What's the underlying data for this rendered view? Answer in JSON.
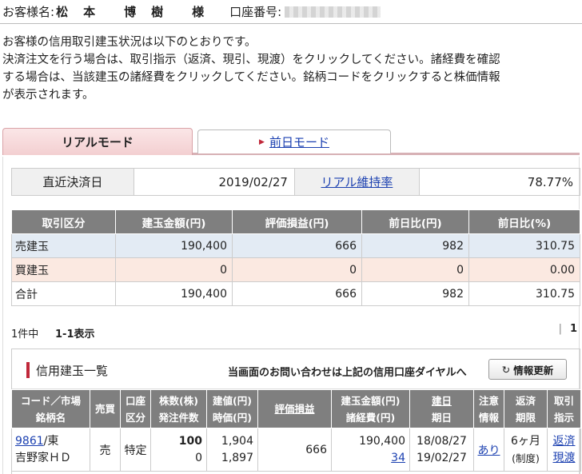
{
  "header": {
    "customer_label": "お客様名:",
    "customer_name": "松　本　　博　樹　　様",
    "account_label": "口座番号:"
  },
  "intro": {
    "line1": "お客様の信用取引建玉状況は以下のとおりです。",
    "line2": "決済注文を行う場合は、取引指示（返済、現引、現渡）をクリックしてください。諸経費を確認",
    "line3": "する場合は、当該建玉の諸経費をクリックしてください。銘柄コードをクリックすると株価情報",
    "line4": "が表示されます。"
  },
  "tabs": {
    "real": "リアルモード",
    "prev": "前日モード"
  },
  "summary": {
    "settle_label": "直近決済日",
    "settle_value": "2019/02/27",
    "ratio_label": "リアル維持率",
    "ratio_value": "78.77%"
  },
  "positions": {
    "headers": [
      "取引区分",
      "建玉金額(円)",
      "評価損益(円)",
      "前日比(円)",
      "前日比(%)"
    ],
    "rows": [
      [
        "売建玉",
        "190,400",
        "666",
        "982",
        "310.75"
      ],
      [
        "買建玉",
        "0",
        "0",
        "0",
        "0.00"
      ],
      [
        "合計",
        "190,400",
        "666",
        "982",
        "310.75"
      ]
    ]
  },
  "pager": {
    "count": "1件中",
    "range": "1-1表示",
    "sep": "|",
    "page": "1"
  },
  "list": {
    "title": "信用建玉一覧",
    "inquiry": "当画面のお問い合わせは上記の信用口座ダイヤルへ",
    "refresh": "情報更新",
    "headers": {
      "code": [
        "コード／市場",
        "銘柄名"
      ],
      "side": "売買",
      "acct": [
        "口座",
        "区分"
      ],
      "qty": [
        "株数(株)",
        "発注件数"
      ],
      "price": [
        "建値(円)",
        "時価(円)"
      ],
      "pl": "評価損益",
      "amount": [
        "建玉金額(円)",
        "諸経費(円)"
      ],
      "date": [
        "建日",
        "期日"
      ],
      "note": [
        "注意",
        "情報"
      ],
      "term": [
        "返済",
        "期限"
      ],
      "instr": [
        "取引",
        "指示"
      ]
    },
    "row": {
      "code": "9861",
      "market": "/東",
      "name": "吉野家ＨＤ",
      "side": "売",
      "acct": "特定",
      "qty": "100",
      "orders": "0",
      "entry": "1,904",
      "market_price": "1,897",
      "pl": "666",
      "amount": "190,400",
      "fees": "34",
      "open_date": "18/08/27",
      "due_date": "19/02/27",
      "note": "あり",
      "term": "6ヶ月",
      "term2": "(制度)",
      "repay": "返済",
      "deliver": "現渡"
    }
  }
}
